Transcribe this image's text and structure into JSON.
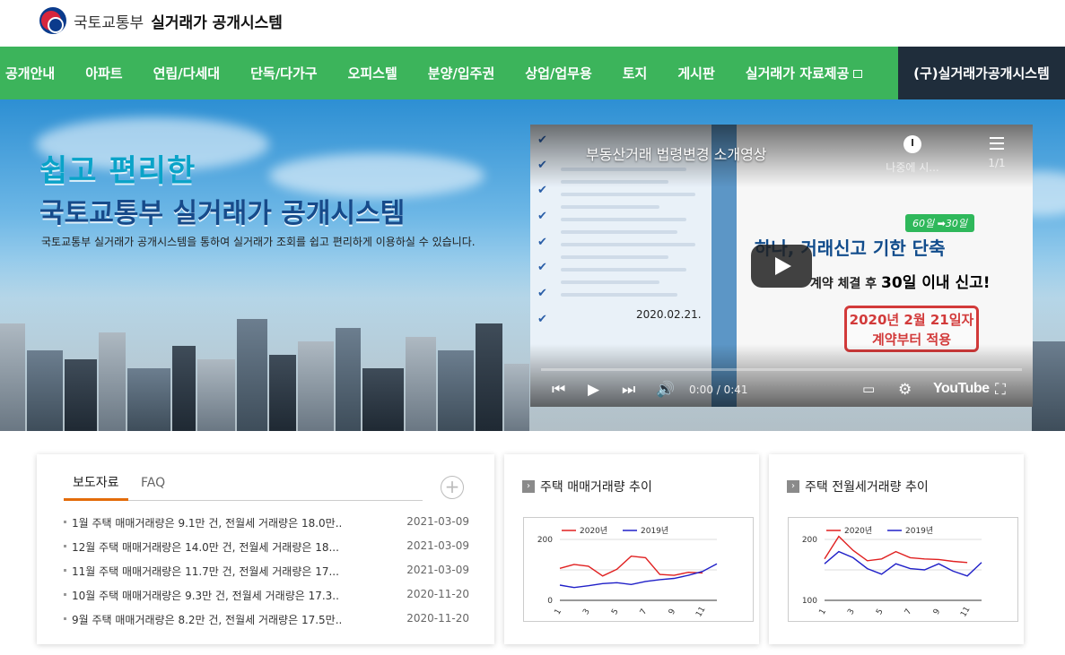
{
  "header": {
    "ministry": "국토교통부",
    "system": "실거래가 공개시스템"
  },
  "nav": {
    "items": [
      "공개안내",
      "아파트",
      "연립/다세대",
      "단독/다가구",
      "오피스텔",
      "분양/입주권",
      "상업/업무용",
      "토지",
      "게시판",
      "실거래가 자료제공"
    ],
    "special": "(구)실거래가공개시스템"
  },
  "hero": {
    "title1": "쉽고 편리한",
    "title2": "국토교통부 실거래가 공개시스템",
    "desc": "국토교통부 실거래가 공개시스템을 통하여 실거래가 조회를 쉽고 편리하게 이용하실 수 있습니다."
  },
  "video": {
    "title": "부동산거래 법령변경 소개영상",
    "watch_later": "나중에 시...",
    "playlist": "1/1",
    "date": "2020.02.21.",
    "badge": "60일 ➡30일",
    "headline": "하나, 거래신고 기한 단축",
    "sub_prefix": "계약 체결 후",
    "sub_bold": "30일 이내 신고!",
    "stamp_line1": "2020년 2월 21일자",
    "stamp_line2": "계약부터 적용",
    "time": "0:00 / 0:41",
    "brand": "YouTube"
  },
  "board": {
    "tab_active": "보도자료",
    "tab_other": "FAQ",
    "more": "+",
    "items": [
      {
        "title": "1월 주택 매매거래량은 9.1만 건, 전월세 거래량은 18.0만..",
        "date": "2021-03-09"
      },
      {
        "title": "12월 주택 매매거래량은 14.0만 건, 전월세 거래량은 18...",
        "date": "2021-03-09"
      },
      {
        "title": "11월 주택 매매거래량은 11.7만 건, 전월세 거래량은 17...",
        "date": "2021-03-09"
      },
      {
        "title": "10월 주택 매매거래량은 9.3만 건, 전월세 거래량은 17.3..",
        "date": "2020-11-20"
      },
      {
        "title": "9월 주택 매매거래량은 8.2만 건, 전월세 거래량은 17.5만..",
        "date": "2020-11-20"
      }
    ]
  },
  "chart_data": [
    {
      "type": "line",
      "title": "주택 매매거래량 추이",
      "x": [
        1,
        2,
        3,
        4,
        5,
        6,
        7,
        8,
        9,
        10,
        11,
        12
      ],
      "xticks": [
        "1",
        "3",
        "5",
        "7",
        "9",
        "11"
      ],
      "yticks": [
        "200",
        "0"
      ],
      "ylim": [
        0,
        200
      ],
      "series": [
        {
          "name": "2020년",
          "color": "#e02020",
          "values": [
            105,
            118,
            112,
            80,
            102,
            145,
            140,
            85,
            82,
            92,
            90,
            null
          ]
        },
        {
          "name": "2019년",
          "color": "#2020c8",
          "values": [
            50,
            42,
            48,
            55,
            58,
            52,
            62,
            68,
            72,
            82,
            95,
            120
          ]
        }
      ]
    },
    {
      "type": "line",
      "title": "주택 전월세거래량 추이",
      "x": [
        1,
        2,
        3,
        4,
        5,
        6,
        7,
        8,
        9,
        10,
        11,
        12
      ],
      "xticks": [
        "1",
        "3",
        "5",
        "7",
        "9",
        "11"
      ],
      "yticks": [
        "200",
        "100"
      ],
      "ylim": [
        100,
        200
      ],
      "series": [
        {
          "name": "2020년",
          "color": "#e02020",
          "values": [
            168,
            205,
            182,
            165,
            168,
            180,
            170,
            168,
            167,
            164,
            162,
            null
          ]
        },
        {
          "name": "2019년",
          "color": "#2020c8",
          "values": [
            160,
            180,
            170,
            152,
            143,
            160,
            152,
            150,
            160,
            148,
            140,
            162
          ]
        }
      ]
    }
  ]
}
